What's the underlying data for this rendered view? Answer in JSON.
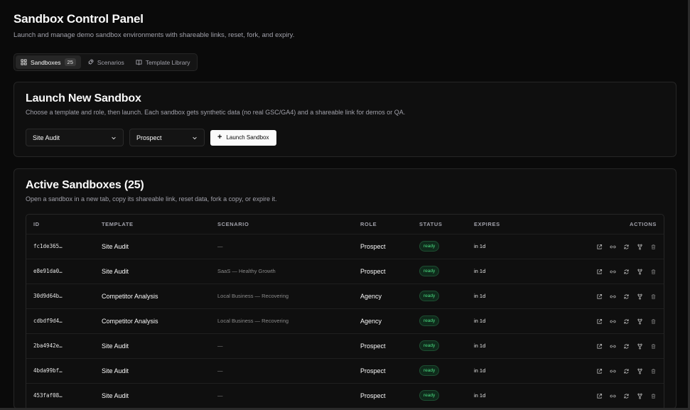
{
  "header": {
    "title": "Sandbox Control Panel",
    "subtitle": "Launch and manage demo sandbox environments with shareable links, reset, fork, and expiry."
  },
  "tabs": [
    {
      "label": "Sandboxes",
      "badge": "25",
      "icon": "grid-icon",
      "active": true
    },
    {
      "label": "Scenarios",
      "icon": "rocket-icon"
    },
    {
      "label": "Template Library",
      "icon": "book-icon"
    }
  ],
  "launch": {
    "title": "Launch New Sandbox",
    "description": "Choose a template and role, then launch. Each sandbox gets synthetic data (no real GSC/GA4) and a shareable link for demos or QA.",
    "template_value": "Site Audit",
    "role_value": "Prospect",
    "button_label": "Launch Sandbox"
  },
  "active": {
    "title": "Active Sandboxes (25)",
    "description": "Open a sandbox in a new tab, copy its shareable link, reset data, fork a copy, or expire it.",
    "columns": [
      "ID",
      "TEMPLATE",
      "SCENARIO",
      "ROLE",
      "STATUS",
      "EXPIRES",
      "ACTIONS"
    ],
    "rows": [
      {
        "id": "fc1de365…",
        "template": "Site Audit",
        "scenario": "—",
        "role": "Prospect",
        "status": "ready",
        "expires": "in 1d"
      },
      {
        "id": "e8e91da0…",
        "template": "Site Audit",
        "scenario": "SaaS — Healthy Growth",
        "role": "Prospect",
        "status": "ready",
        "expires": "in 1d"
      },
      {
        "id": "30d9d64b…",
        "template": "Competitor Analysis",
        "scenario": "Local Business — Recovering",
        "role": "Agency",
        "status": "ready",
        "expires": "in 1d"
      },
      {
        "id": "cdbdf9d4…",
        "template": "Competitor Analysis",
        "scenario": "Local Business — Recovering",
        "role": "Agency",
        "status": "ready",
        "expires": "in 1d"
      },
      {
        "id": "2ba4942e…",
        "template": "Site Audit",
        "scenario": "—",
        "role": "Prospect",
        "status": "ready",
        "expires": "in 1d"
      },
      {
        "id": "4bda99bf…",
        "template": "Site Audit",
        "scenario": "—",
        "role": "Prospect",
        "status": "ready",
        "expires": "in 1d"
      },
      {
        "id": "453faf08…",
        "template": "Site Audit",
        "scenario": "—",
        "role": "Prospect",
        "status": "ready",
        "expires": "in 1d"
      }
    ],
    "row_actions": [
      "external-link-icon",
      "link-icon",
      "refresh-icon",
      "fork-icon",
      "trash-icon"
    ]
  },
  "colors": {
    "background": "#0a0a0a",
    "card": "#0f0f0f",
    "border": "#262626",
    "muted_text": "#a1a1aa",
    "status_ready": "#4ade80"
  }
}
